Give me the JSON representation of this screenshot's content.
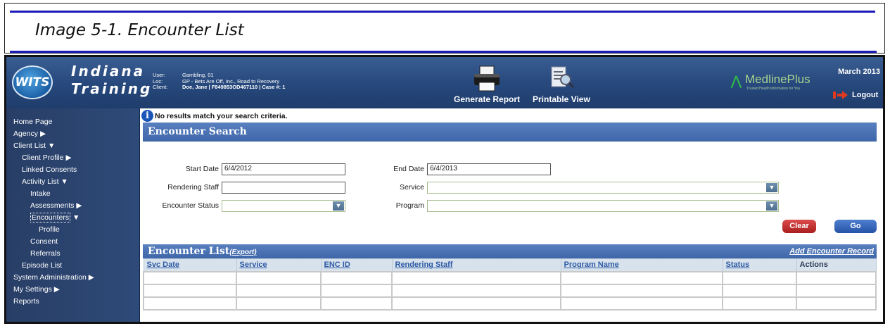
{
  "caption": "Image 5-1. Encounter List",
  "header": {
    "logo_text": "WITS",
    "org_line1": "Indiana",
    "org_line2": "Training",
    "user_key": "User:",
    "user_val": "Gambling, 01",
    "loc_key": "Loc:",
    "loc_val": "GP - Bets Are Off, Inc., Road to Recovery",
    "client_key": "Client:",
    "client_val": "Doe, Jane | F849853OD467110 | Case #: 1",
    "generate_report": "Generate Report",
    "printable_view": "Printable View",
    "medline": "MedlinePlus",
    "medline_sub": "Trusted Health Information for You",
    "date": "March 2013",
    "logout": "Logout"
  },
  "sidebar": {
    "items": [
      {
        "label": "Home Page"
      },
      {
        "label": "Agency ▶"
      },
      {
        "label": "Client List ▼"
      },
      {
        "label": "Client Profile ▶"
      },
      {
        "label": "Linked Consents"
      },
      {
        "label": "Activity List ▼"
      },
      {
        "label": "Intake"
      },
      {
        "label": "Assessments ▶"
      },
      {
        "label": "Encounters"
      },
      {
        "label": "Profile"
      },
      {
        "label": "Consent"
      },
      {
        "label": "Referrals"
      },
      {
        "label": "Episode List"
      },
      {
        "label": "System Administration ▶"
      },
      {
        "label": "My Settings ▶"
      },
      {
        "label": "Reports"
      }
    ],
    "encounters_arrow": "▼"
  },
  "main": {
    "message": "No results match your search criteria.",
    "search_title": "Encounter Search",
    "start_date_label": "Start Date",
    "start_date_value": "6/4/2012",
    "end_date_label": "End Date",
    "end_date_value": "6/4/2013",
    "rendering_staff_label": "Rendering Staff",
    "rendering_staff_value": "",
    "service_label": "Service",
    "encounter_status_label": "Encounter Status",
    "program_label": "Program",
    "clear_label": "Clear",
    "go_label": "Go",
    "list_title": "Encounter List",
    "export_label": "(Export)",
    "add_record_label": "Add Encounter Record",
    "columns": [
      "Svc Date",
      "Service",
      "ENC ID",
      "Rendering Staff",
      "Program Name",
      "Status",
      "Actions"
    ]
  }
}
